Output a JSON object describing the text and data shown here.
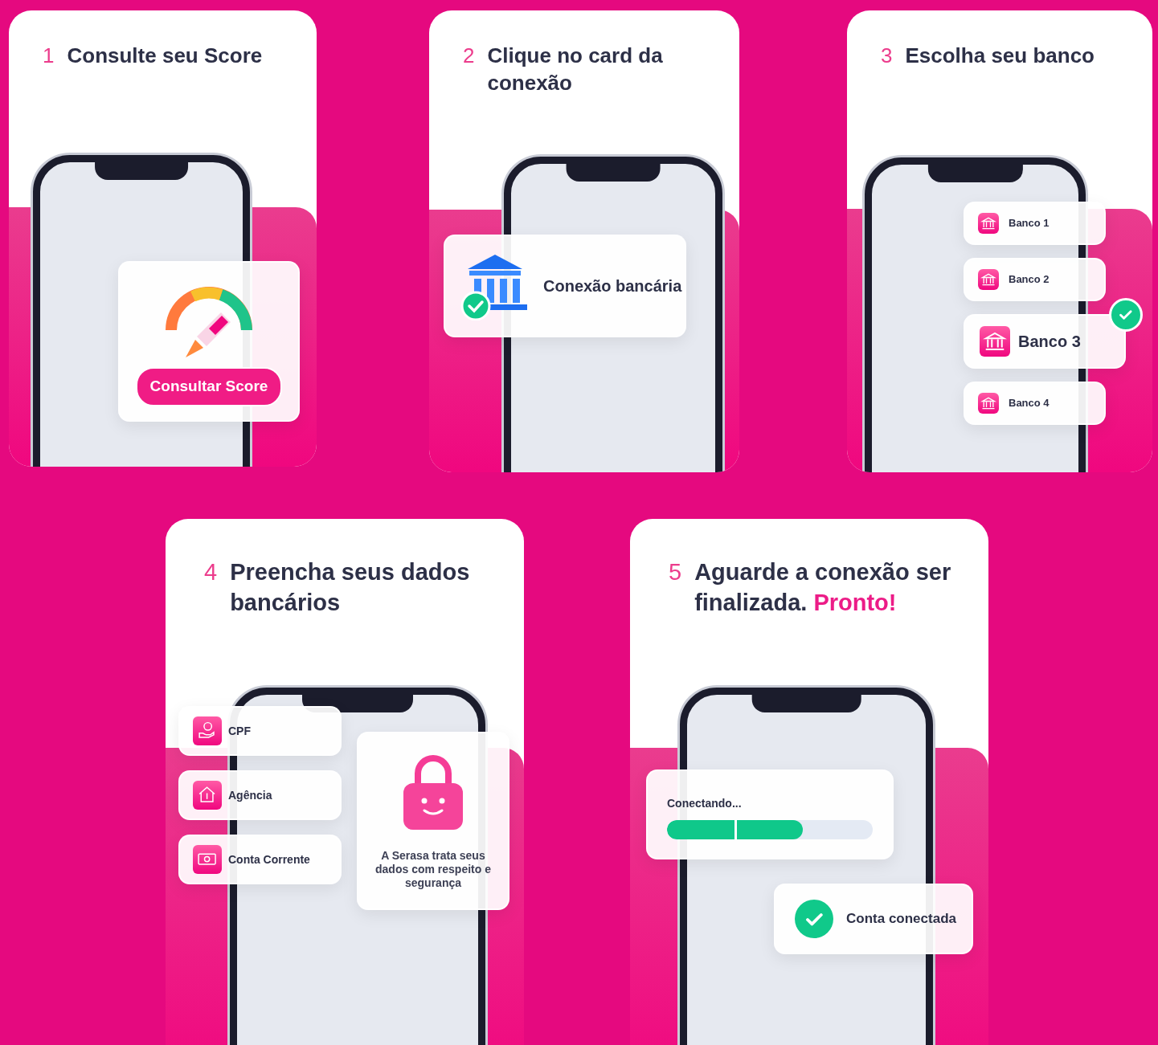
{
  "steps": [
    {
      "number": "1",
      "title": "Consulte seu Score",
      "kind": "score",
      "button": "Consultar Score"
    },
    {
      "number": "2",
      "title": "Clique no card da conexão",
      "kind": "connection",
      "card_label": "Conexão bancária"
    },
    {
      "number": "3",
      "title": "Escolha seu banco",
      "kind": "banks",
      "banks": [
        {
          "label": "Banco 1",
          "selected": false
        },
        {
          "label": "Banco 2",
          "selected": false
        },
        {
          "label": "Banco 3",
          "selected": true
        },
        {
          "label": "Banco 4",
          "selected": false
        }
      ]
    },
    {
      "number": "4",
      "title": "Preencha seus dados bancários",
      "kind": "form",
      "fields": [
        {
          "label": "CPF",
          "kind": "coin"
        },
        {
          "label": "Agência",
          "kind": "house"
        },
        {
          "label": "Conta Corrente",
          "kind": "bill"
        }
      ],
      "security_note": "A Serasa trata seus dados com respeito e  segurança"
    },
    {
      "number": "5",
      "title": "Aguarde a conexão ser finalizada.",
      "highlight": "Pronto!",
      "kind": "progress",
      "progress": {
        "label": "Conectando...",
        "level": 0.66
      },
      "status": "Conta conectada"
    }
  ]
}
